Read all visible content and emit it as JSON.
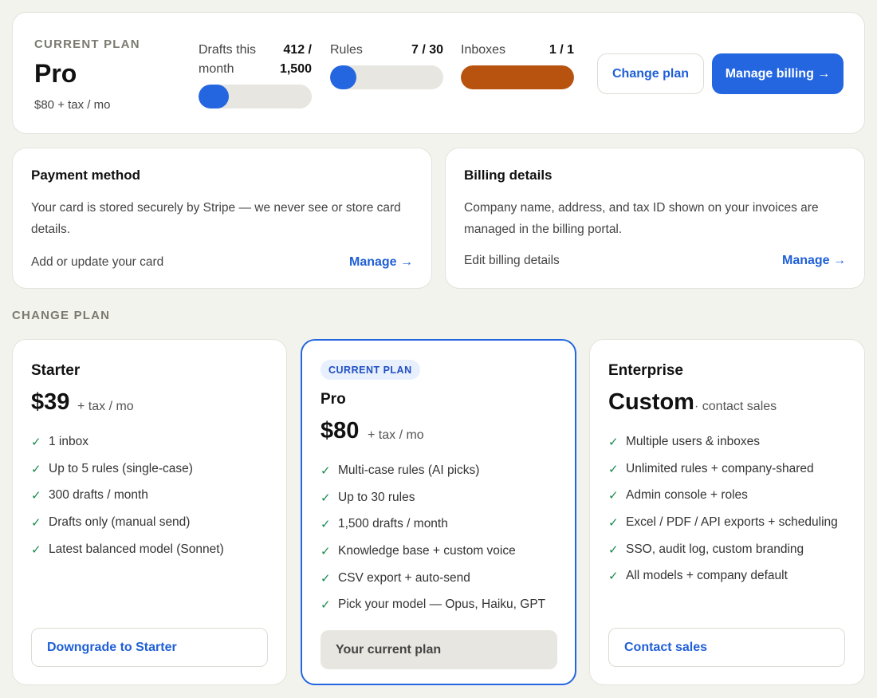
{
  "current_plan": {
    "eyebrow": "CURRENT PLAN",
    "name": "Pro",
    "price": "$80 + tax / mo",
    "usage": [
      {
        "label": "Drafts this month",
        "value": "412 / 1,500",
        "used": 412,
        "limit": 1500,
        "fill_fraction": 0.27,
        "color": "#2466e0"
      },
      {
        "label": "Rules",
        "value": "7 / 30",
        "used": 7,
        "limit": 30,
        "fill_fraction": 0.233,
        "color": "#2466e0"
      },
      {
        "label": "Inboxes",
        "value": "1 / 1",
        "used": 1,
        "limit": 1,
        "fill_fraction": 1.0,
        "color": "#b8530f"
      }
    ],
    "change_plan_label": "Change plan",
    "manage_billing_label": "Manage billing →"
  },
  "payment": {
    "title": "Payment method",
    "description": "Your card is stored securely by Stripe — we never see or store card details.",
    "row_label": "Add or update your card",
    "link": "Manage →"
  },
  "billing": {
    "title": "Billing details",
    "description": "Company name, address, and tax ID shown on your invoices are managed in the billing portal.",
    "row_label": "Edit billing details",
    "link": "Manage →"
  },
  "change_plan_heading": "CHANGE PLAN",
  "tiers": {
    "starter": {
      "name": "Starter",
      "price": "$39",
      "suffix": "+ tax / mo",
      "features": [
        "1 inbox",
        "Up to 5 rules (single-case)",
        "300 drafts / month",
        "Drafts only (manual send)",
        "Latest balanced model (Sonnet)"
      ],
      "button": "Downgrade to Starter"
    },
    "pro": {
      "badge": "CURRENT PLAN",
      "name": "Pro",
      "price": "$80",
      "suffix": "+ tax / mo",
      "features": [
        "Multi-case rules (AI picks)",
        "Up to 30 rules",
        "1,500 drafts / month",
        "Knowledge base + custom voice",
        "CSV export + auto-send",
        "Pick your model — Opus, Haiku, GPT"
      ],
      "button": "Your current plan"
    },
    "enterprise": {
      "name": "Enterprise",
      "price": "Custom",
      "suffix": "· contact sales",
      "features": [
        "Multiple users & inboxes",
        "Unlimited rules + company-shared",
        "Admin console + roles",
        "Excel / PDF / API exports + scheduling",
        "SSO, audit log, custom branding",
        "All models + company default"
      ],
      "button": "Contact sales"
    }
  },
  "check_icon": "✓",
  "colors": {
    "accent": "#2466e0",
    "check": "#1b8a4c",
    "warning": "#b8530f",
    "background": "#f3f3ee"
  }
}
